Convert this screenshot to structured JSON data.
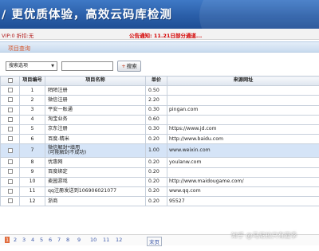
{
  "banner": {
    "title": "/ 更优质体验，高效云码库检测"
  },
  "notice_bar": {
    "vip": "VIP:0 折扣:无",
    "notice": "公告通知: 11.21日部分通道..."
  },
  "section": {
    "title": "项目查询"
  },
  "search": {
    "select_value": "搜索选项",
    "input_value": "",
    "button_label": "搜索"
  },
  "table": {
    "headers": [
      "项目编号",
      "项目名称",
      "单价",
      "来源网址"
    ],
    "rows": [
      {
        "id": "1",
        "name": "陌陌注册",
        "name2": "",
        "price": "0.50",
        "url": ""
      },
      {
        "id": "2",
        "name": "微信注册",
        "name2": "",
        "price": "2.20",
        "url": ""
      },
      {
        "id": "3",
        "name": "平安一账通",
        "name2": "",
        "price": "0.30",
        "url": "pingan.com"
      },
      {
        "id": "4",
        "name": "淘宝业务",
        "name2": "",
        "price": "0.60",
        "url": ""
      },
      {
        "id": "5",
        "name": "京东注册",
        "name2": "",
        "price": "0.30",
        "url": "https://www.jd.com"
      },
      {
        "id": "6",
        "name": "百度-精米",
        "name2": "",
        "price": "0.20",
        "url": "http://www.baidu.com"
      },
      {
        "id": "7",
        "name": "微信解封*填用",
        "name2": "(可能解封不成功)",
        "price": "1.00",
        "url": "www.weixin.com"
      },
      {
        "id": "8",
        "name": "优惠网",
        "name2": "",
        "price": "0.20",
        "url": "youlanw.com"
      },
      {
        "id": "9",
        "name": "百度绑定",
        "name2": "",
        "price": "0.20",
        "url": ""
      },
      {
        "id": "10",
        "name": "麦园游戏",
        "name2": "",
        "price": "0.20",
        "url": "http://www.maidougame.com/"
      },
      {
        "id": "11",
        "name": "qq注册发送到106906021077",
        "name2": "",
        "price": "0.20",
        "url": "www.qq.com"
      },
      {
        "id": "12",
        "name": "浙商",
        "name2": "",
        "price": "0.20",
        "url": "95527"
      }
    ]
  },
  "pager": {
    "pages": [
      "1",
      "2",
      "3",
      "4",
      "5",
      "6",
      "7",
      "8",
      "9",
      "10",
      "11",
      "12"
    ],
    "current": "1",
    "next": "末页"
  },
  "watermark": "知乎 @马尼拉只有夏季"
}
